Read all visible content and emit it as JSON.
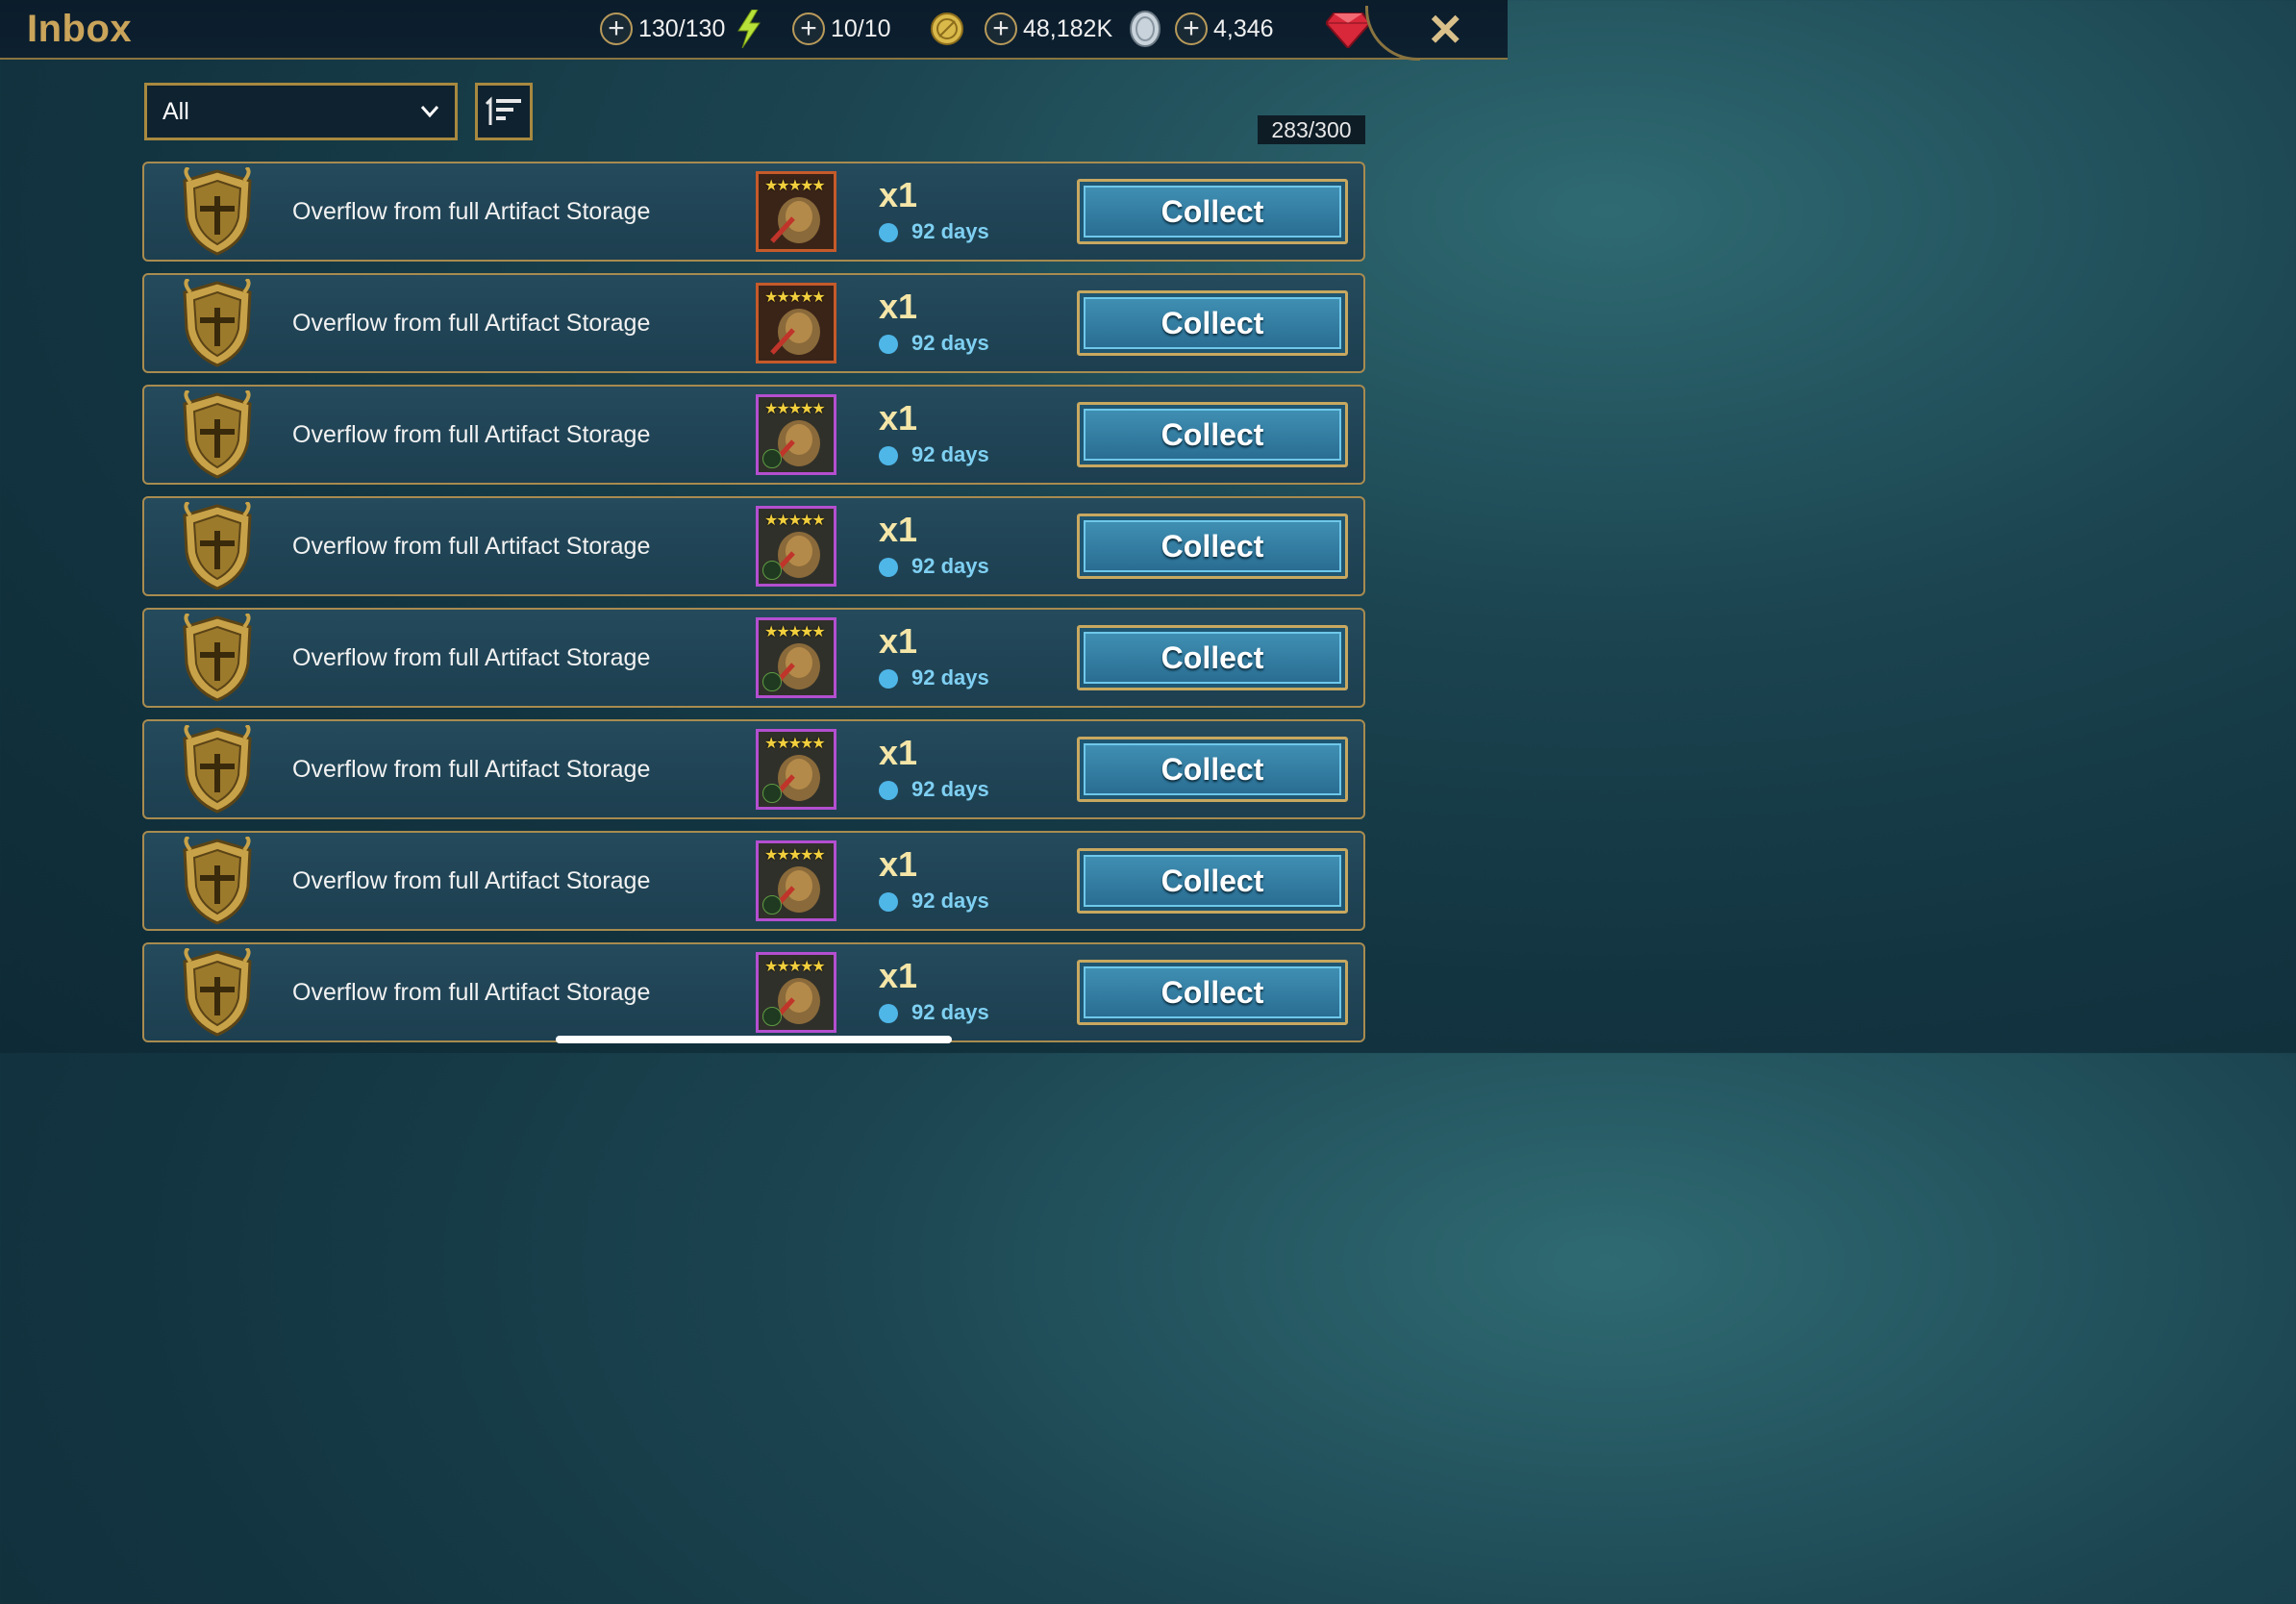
{
  "header": {
    "title": "Inbox",
    "close_label": "✕",
    "resources": [
      {
        "name": "energy",
        "value": "130/130",
        "icon": "lightning-icon"
      },
      {
        "name": "arena-tokens",
        "value": "10/10",
        "icon": "gold-coin-icon"
      },
      {
        "name": "silver",
        "value": "48,182K",
        "icon": "silver-coin-icon"
      },
      {
        "name": "gems",
        "value": "4,346",
        "icon": "ruby-gem-icon"
      }
    ]
  },
  "filter": {
    "selected": "All",
    "capacity": "283/300"
  },
  "messages": [
    {
      "text": "Overflow from full Artifact Storage",
      "qty": "x1",
      "expires": "92 days",
      "rarity": "legendary",
      "artifact_icon": "helmet-icon",
      "stars": "★★★★★",
      "button": "Collect"
    },
    {
      "text": "Overflow from full Artifact Storage",
      "qty": "x1",
      "expires": "92 days",
      "rarity": "legendary",
      "artifact_icon": "axe-icon",
      "stars": "★★★★★",
      "button": "Collect"
    },
    {
      "text": "Overflow from full Artifact Storage",
      "qty": "x1",
      "expires": "92 days",
      "rarity": "epic",
      "artifact_icon": "chestplate-icon",
      "stars": "★★★★★",
      "button": "Collect"
    },
    {
      "text": "Overflow from full Artifact Storage",
      "qty": "x1",
      "expires": "92 days",
      "rarity": "epic",
      "artifact_icon": "hood-icon",
      "stars": "★★★★★",
      "button": "Collect"
    },
    {
      "text": "Overflow from full Artifact Storage",
      "qty": "x1",
      "expires": "92 days",
      "rarity": "epic",
      "artifact_icon": "chestplate-icon",
      "stars": "★★★★★",
      "button": "Collect"
    },
    {
      "text": "Overflow from full Artifact Storage",
      "qty": "x1",
      "expires": "92 days",
      "rarity": "epic",
      "artifact_icon": "chestplate-icon",
      "stars": "★★★★★",
      "button": "Collect"
    },
    {
      "text": "Overflow from full Artifact Storage",
      "qty": "x1",
      "expires": "92 days",
      "rarity": "epic",
      "artifact_icon": "gauntlet-icon",
      "stars": "★★★★★",
      "button": "Collect"
    },
    {
      "text": "Overflow from full Artifact Storage",
      "qty": "x1",
      "expires": "92 days",
      "rarity": "epic",
      "artifact_icon": "bow-icon",
      "stars": "★★★★★",
      "button": "Collect"
    }
  ],
  "colors": {
    "gold": "#c9a45a",
    "legendary_border": "#c55a2a",
    "epic_border": "#b44fd0",
    "button_blue": "#2a6d92",
    "timer_blue": "#7fd0f2"
  }
}
